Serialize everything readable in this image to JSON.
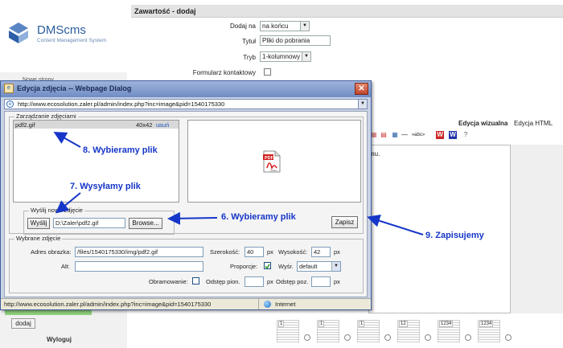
{
  "background": {
    "logo": {
      "name": "DMScms",
      "tagline": "Content Management System"
    },
    "sidebar": {
      "menu_hint": "Nowe strony",
      "add_button": "dodaj",
      "logout": "Wyloguj"
    },
    "section_title": "Zawartość - dodaj",
    "form": {
      "add_on_label": "Dodaj na",
      "add_on_value": "na końcu",
      "title_label": "Tytuł",
      "title_value": "Pliki do pobrania",
      "mode_label": "Tryb",
      "mode_value": "1-kolumnowy",
      "contact_form_label": "Formularz kontaktowy"
    },
    "editor": {
      "tab_visual": "Edycja wizualna",
      "tab_html": "Edycja HTML",
      "content_snippet": "mu."
    },
    "layout_thumbs": [
      "1",
      "1",
      "1",
      "12",
      "1234",
      "1234"
    ]
  },
  "dialog": {
    "title": "Edycja zdjęcia -- Webpage Dialog",
    "url": "http://www.ecosolution.zaler.pl/admin/index.php?inc=image&pid=1540175330",
    "manage_legend": "Zarządzanie zdjęciami",
    "file": {
      "name": "pdf2.gif",
      "dims": "40x42",
      "delete": "usuń"
    },
    "upload": {
      "legend": "Wyślij nowe zdjęcie",
      "send_button": "Wyślij",
      "path_value": "D:\\Zaler\\pdf2.gif",
      "browse_button": "Browse..."
    },
    "save_button": "Zapisz",
    "selected": {
      "legend": "Wybrane zdjęcie",
      "address_label": "Adres obrazka:",
      "address_value": "/files/1540175330/img/pdf2.gif",
      "width_label": "Szerokość:",
      "width_value": "40",
      "height_label": "Wysokość:",
      "height_value": "42",
      "px": "px",
      "alt_label": "Alt:",
      "alt_value": "",
      "proportions_label": "Proporcje:",
      "align_label": "Wyśr.",
      "align_value": "default",
      "border_label": "Obramowanie:",
      "vspace_label": "Odstęp pion.",
      "vspace_value": "",
      "hspace_label": "Odstęp poz.",
      "hspace_value": ""
    },
    "status": {
      "url": "http://www.ecosolution.zaler.pl/admin/index.php?inc=image&pid=1540175330",
      "zone": "Internet"
    }
  },
  "annotations": {
    "choose_file_list": "8. Wybieramy plik",
    "send_file": "7. Wysyłamy plik",
    "choose_file_browse": "6. Wybieramy plik",
    "save": "9. Zapisujemy"
  },
  "colors": {
    "annotation": "#1536c8",
    "dialog_title": "#6f8cc4",
    "header_bar": "#e3e3e3"
  }
}
